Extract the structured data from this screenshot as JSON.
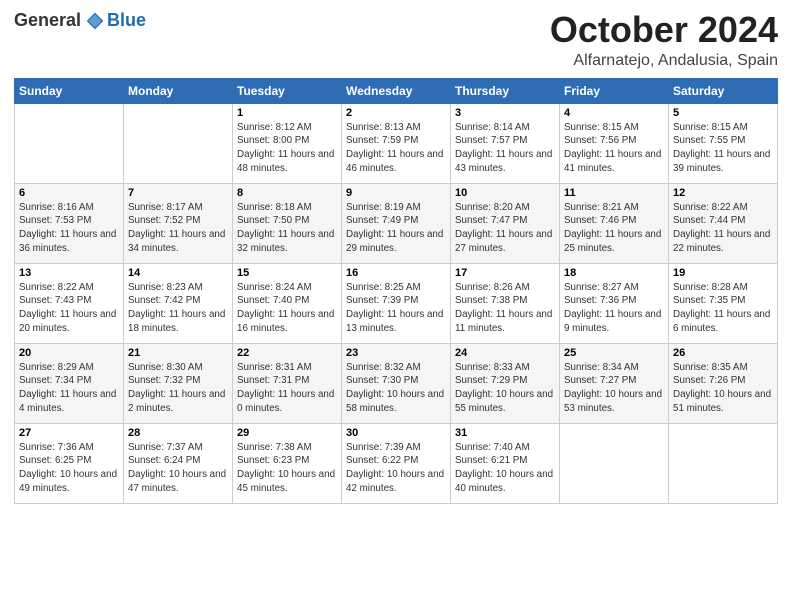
{
  "logo": {
    "general": "General",
    "blue": "Blue"
  },
  "title": "October 2024",
  "location": "Alfarnatejo, Andalusia, Spain",
  "weekdays": [
    "Sunday",
    "Monday",
    "Tuesday",
    "Wednesday",
    "Thursday",
    "Friday",
    "Saturday"
  ],
  "weeks": [
    [
      {
        "day": "",
        "info": ""
      },
      {
        "day": "",
        "info": ""
      },
      {
        "day": "1",
        "info": "Sunrise: 8:12 AM\nSunset: 8:00 PM\nDaylight: 11 hours and 48 minutes."
      },
      {
        "day": "2",
        "info": "Sunrise: 8:13 AM\nSunset: 7:59 PM\nDaylight: 11 hours and 46 minutes."
      },
      {
        "day": "3",
        "info": "Sunrise: 8:14 AM\nSunset: 7:57 PM\nDaylight: 11 hours and 43 minutes."
      },
      {
        "day": "4",
        "info": "Sunrise: 8:15 AM\nSunset: 7:56 PM\nDaylight: 11 hours and 41 minutes."
      },
      {
        "day": "5",
        "info": "Sunrise: 8:15 AM\nSunset: 7:55 PM\nDaylight: 11 hours and 39 minutes."
      }
    ],
    [
      {
        "day": "6",
        "info": "Sunrise: 8:16 AM\nSunset: 7:53 PM\nDaylight: 11 hours and 36 minutes."
      },
      {
        "day": "7",
        "info": "Sunrise: 8:17 AM\nSunset: 7:52 PM\nDaylight: 11 hours and 34 minutes."
      },
      {
        "day": "8",
        "info": "Sunrise: 8:18 AM\nSunset: 7:50 PM\nDaylight: 11 hours and 32 minutes."
      },
      {
        "day": "9",
        "info": "Sunrise: 8:19 AM\nSunset: 7:49 PM\nDaylight: 11 hours and 29 minutes."
      },
      {
        "day": "10",
        "info": "Sunrise: 8:20 AM\nSunset: 7:47 PM\nDaylight: 11 hours and 27 minutes."
      },
      {
        "day": "11",
        "info": "Sunrise: 8:21 AM\nSunset: 7:46 PM\nDaylight: 11 hours and 25 minutes."
      },
      {
        "day": "12",
        "info": "Sunrise: 8:22 AM\nSunset: 7:44 PM\nDaylight: 11 hours and 22 minutes."
      }
    ],
    [
      {
        "day": "13",
        "info": "Sunrise: 8:22 AM\nSunset: 7:43 PM\nDaylight: 11 hours and 20 minutes."
      },
      {
        "day": "14",
        "info": "Sunrise: 8:23 AM\nSunset: 7:42 PM\nDaylight: 11 hours and 18 minutes."
      },
      {
        "day": "15",
        "info": "Sunrise: 8:24 AM\nSunset: 7:40 PM\nDaylight: 11 hours and 16 minutes."
      },
      {
        "day": "16",
        "info": "Sunrise: 8:25 AM\nSunset: 7:39 PM\nDaylight: 11 hours and 13 minutes."
      },
      {
        "day": "17",
        "info": "Sunrise: 8:26 AM\nSunset: 7:38 PM\nDaylight: 11 hours and 11 minutes."
      },
      {
        "day": "18",
        "info": "Sunrise: 8:27 AM\nSunset: 7:36 PM\nDaylight: 11 hours and 9 minutes."
      },
      {
        "day": "19",
        "info": "Sunrise: 8:28 AM\nSunset: 7:35 PM\nDaylight: 11 hours and 6 minutes."
      }
    ],
    [
      {
        "day": "20",
        "info": "Sunrise: 8:29 AM\nSunset: 7:34 PM\nDaylight: 11 hours and 4 minutes."
      },
      {
        "day": "21",
        "info": "Sunrise: 8:30 AM\nSunset: 7:32 PM\nDaylight: 11 hours and 2 minutes."
      },
      {
        "day": "22",
        "info": "Sunrise: 8:31 AM\nSunset: 7:31 PM\nDaylight: 11 hours and 0 minutes."
      },
      {
        "day": "23",
        "info": "Sunrise: 8:32 AM\nSunset: 7:30 PM\nDaylight: 10 hours and 58 minutes."
      },
      {
        "day": "24",
        "info": "Sunrise: 8:33 AM\nSunset: 7:29 PM\nDaylight: 10 hours and 55 minutes."
      },
      {
        "day": "25",
        "info": "Sunrise: 8:34 AM\nSunset: 7:27 PM\nDaylight: 10 hours and 53 minutes."
      },
      {
        "day": "26",
        "info": "Sunrise: 8:35 AM\nSunset: 7:26 PM\nDaylight: 10 hours and 51 minutes."
      }
    ],
    [
      {
        "day": "27",
        "info": "Sunrise: 7:36 AM\nSunset: 6:25 PM\nDaylight: 10 hours and 49 minutes."
      },
      {
        "day": "28",
        "info": "Sunrise: 7:37 AM\nSunset: 6:24 PM\nDaylight: 10 hours and 47 minutes."
      },
      {
        "day": "29",
        "info": "Sunrise: 7:38 AM\nSunset: 6:23 PM\nDaylight: 10 hours and 45 minutes."
      },
      {
        "day": "30",
        "info": "Sunrise: 7:39 AM\nSunset: 6:22 PM\nDaylight: 10 hours and 42 minutes."
      },
      {
        "day": "31",
        "info": "Sunrise: 7:40 AM\nSunset: 6:21 PM\nDaylight: 10 hours and 40 minutes."
      },
      {
        "day": "",
        "info": ""
      },
      {
        "day": "",
        "info": ""
      }
    ]
  ]
}
